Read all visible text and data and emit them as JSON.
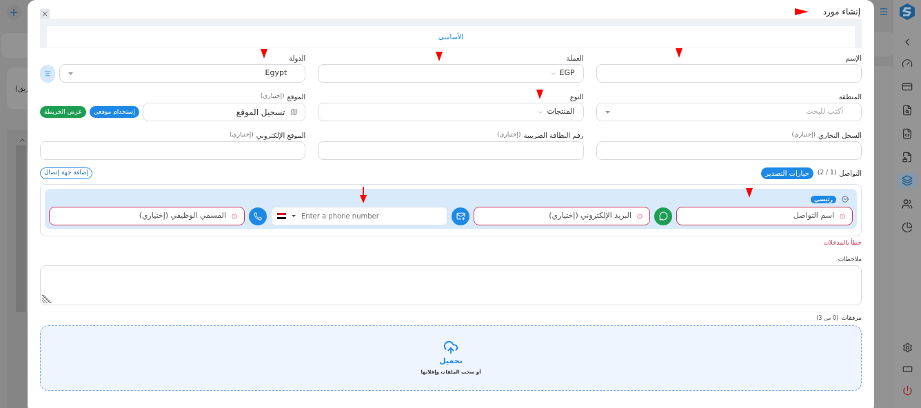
{
  "background": {
    "cut_text": "ريق)"
  },
  "modal": {
    "title": "إنشاء مورد",
    "tabs": [
      {
        "label": "الأساسي",
        "selected": true
      }
    ],
    "fields": [
      {
        "kind": "text",
        "label": "الإسم"
      },
      {
        "kind": "select",
        "label": "العملة",
        "value": "EGP"
      },
      {
        "kind": "country",
        "label": "الدولة",
        "value": "Egypt"
      },
      {
        "kind": "search",
        "label": "المنطقة",
        "placeholder": "أكتب للبحث"
      },
      {
        "kind": "select",
        "label": "النوع",
        "value": "المنتجات"
      },
      {
        "kind": "location",
        "label": "الموقع",
        "note": "(إختياري)",
        "value": "تسجيل الموقع",
        "buttons": [
          {
            "label": "إستخدام موقعي",
            "color": "#1e88e5"
          },
          {
            "label": "عرض الخريطة",
            "color": "#1e9e54"
          }
        ]
      },
      {
        "kind": "text",
        "label": "السجل التجاري",
        "note": "(إختياري)"
      },
      {
        "kind": "text",
        "label": "رقم البطاقة الضريبية",
        "note": "(إختياري)"
      },
      {
        "kind": "text",
        "label": "الموقع الإلكتروني",
        "note": "(إختياري)"
      }
    ],
    "contacts": {
      "label": "التواصل",
      "count": "(1 / 2)",
      "export_button": "خيارات التصدير",
      "add_button": "إضافة جهة إتصال",
      "items": [
        {
          "badge": "رئيسي",
          "expanded": true,
          "invalid": true,
          "name_placeholder": "اسم التواصل",
          "email_placeholder": "البريد الإلكتروني (إختياري)",
          "phone_placeholder": "Enter a phone number",
          "job_placeholder": "المسمي الوظيفي (إختياري)"
        }
      ],
      "error": "خطأ بالمدخلات"
    },
    "notes": {
      "label": "ملاحظات"
    },
    "attachments": {
      "label": "مرفقات",
      "count": "(0 من 3)",
      "upload": "تحميل",
      "hint": "أو سحب الملفات وإفلاتها"
    }
  }
}
